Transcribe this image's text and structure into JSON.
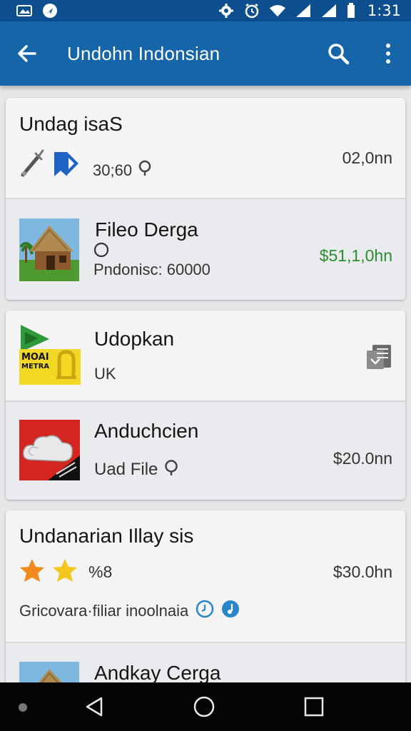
{
  "status_bar": {
    "time": "1:31",
    "icons": [
      "image-icon",
      "navigation-icon",
      "settings-icon",
      "alarm-icon",
      "wifi-icon",
      "signal-icon",
      "signal-icon",
      "battery-icon"
    ]
  },
  "app_bar": {
    "title": "Undohn Indonsian",
    "icons": [
      "back-arrow-icon",
      "search-icon",
      "more-vert-icon"
    ]
  },
  "cards": [
    {
      "rows": [
        {
          "title": "Undag isaS",
          "meta": "30;60",
          "price": "02,0nn",
          "icons": [
            "wrench-icon",
            "bookmark-icon",
            "location-icon"
          ]
        },
        {
          "title": "Fileo Derga",
          "subtitle": "Pndonisc: 60000",
          "price": "$51,1,0hn",
          "price_color": "#2a8f2c",
          "thumb": "hut-image",
          "icons": [
            "radio-icon"
          ]
        }
      ]
    },
    {
      "rows": [
        {
          "title": "Udopkan",
          "subtitle": "UK",
          "logo_text_top": "MOAI",
          "logo_text_bottom": "METRA",
          "icons": [
            "note-icon"
          ]
        },
        {
          "title": "Anduchcien",
          "subtitle": "Uad File",
          "price": "$20.0nn",
          "thumb": "cloud-image",
          "icons": [
            "location-icon"
          ]
        }
      ]
    },
    {
      "rows": [
        {
          "title": "Undanarian Illay sis",
          "rating_text": "%8",
          "price": "$30.0hn",
          "description": "Gricovara·filiar inoolnaia",
          "icons": [
            "star-icon",
            "star-icon",
            "clock-icon",
            "music-icon"
          ]
        },
        {
          "title": "Andkay Cerga",
          "thumb": "hut-image"
        }
      ]
    }
  ],
  "nav_bar": {
    "icons": [
      "back-icon",
      "home-icon",
      "recents-icon"
    ]
  }
}
